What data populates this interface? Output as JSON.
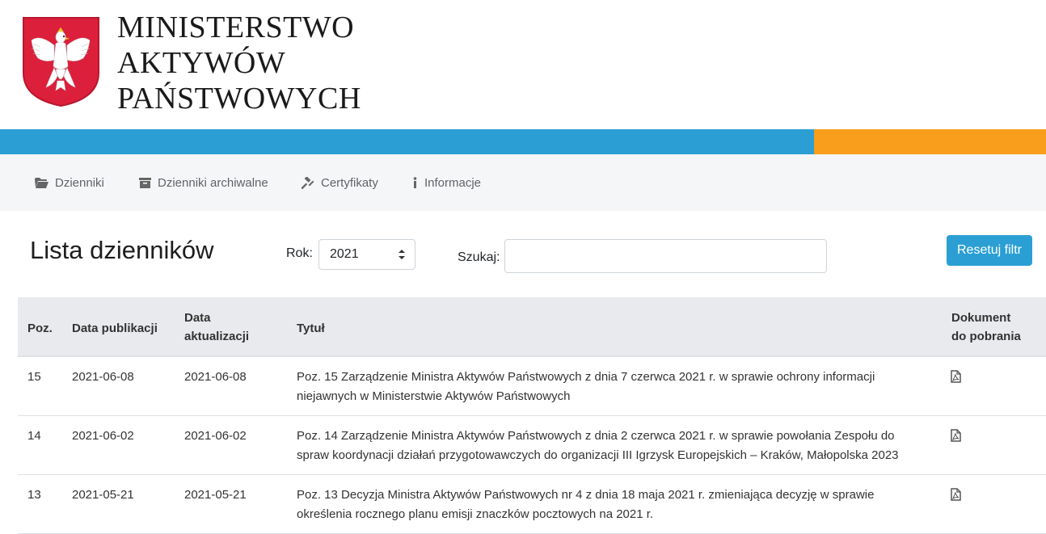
{
  "header": {
    "ministry_line1": "MINISTERSTWO",
    "ministry_line2": "AKTYWÓW",
    "ministry_line3": "PAŃSTWOWYCH"
  },
  "colors": {
    "blue": "#2b9fd4",
    "orange": "#f99d1c",
    "emblem_red": "#dc1f3a"
  },
  "nav": {
    "items": [
      {
        "label": "Dzienniki",
        "icon": "folder-open-icon"
      },
      {
        "label": "Dzienniki archiwalne",
        "icon": "archive-icon"
      },
      {
        "label": "Certyfikaty",
        "icon": "gavel-icon"
      },
      {
        "label": "Informacje",
        "icon": "info-icon"
      }
    ]
  },
  "main": {
    "title": "Lista dzienników",
    "rok_label": "Rok:",
    "rok_value": "2021",
    "search_label": "Szukaj:",
    "search_value": "",
    "reset_label": "Resetuj filtr"
  },
  "table": {
    "headers": {
      "poz": "Poz.",
      "data_publikacji": "Data publikacji",
      "data_aktualizacji_1": "Data",
      "data_aktualizacji_2": "aktualizacji",
      "tytul": "Tytuł",
      "dokument_1": "Dokument",
      "dokument_2": "do pobrania"
    },
    "rows": [
      {
        "poz": "15",
        "pub": "2021-06-08",
        "akt": "2021-06-08",
        "title_1": "Poz. 15 Zarządzenie Ministra Aktywów Państwowych z dnia 7 czerwca 2021 r. w sprawie ochrony informacji",
        "title_2": "niejawnych w Ministerstwie Aktywów Państwowych"
      },
      {
        "poz": "14",
        "pub": "2021-06-02",
        "akt": "2021-06-02",
        "title_1": "Poz. 14 Zarządzenie Ministra Aktywów Państwowych z dnia 2 czerwca 2021 r. w sprawie powołania Zespołu do",
        "title_2": "spraw koordynacji działań przygotowawczych do organizacji III Igrzysk Europejskich – Kraków, Małopolska 2023"
      },
      {
        "poz": "13",
        "pub": "2021-05-21",
        "akt": "2021-05-21",
        "title_1": "Poz. 13 Decyzja Ministra Aktywów Państwowych nr 4 z dnia 18 maja 2021 r. zmieniająca decyzję w sprawie",
        "title_2": "określenia rocznego planu emisji znaczków pocztowych na 2021 r."
      }
    ]
  }
}
